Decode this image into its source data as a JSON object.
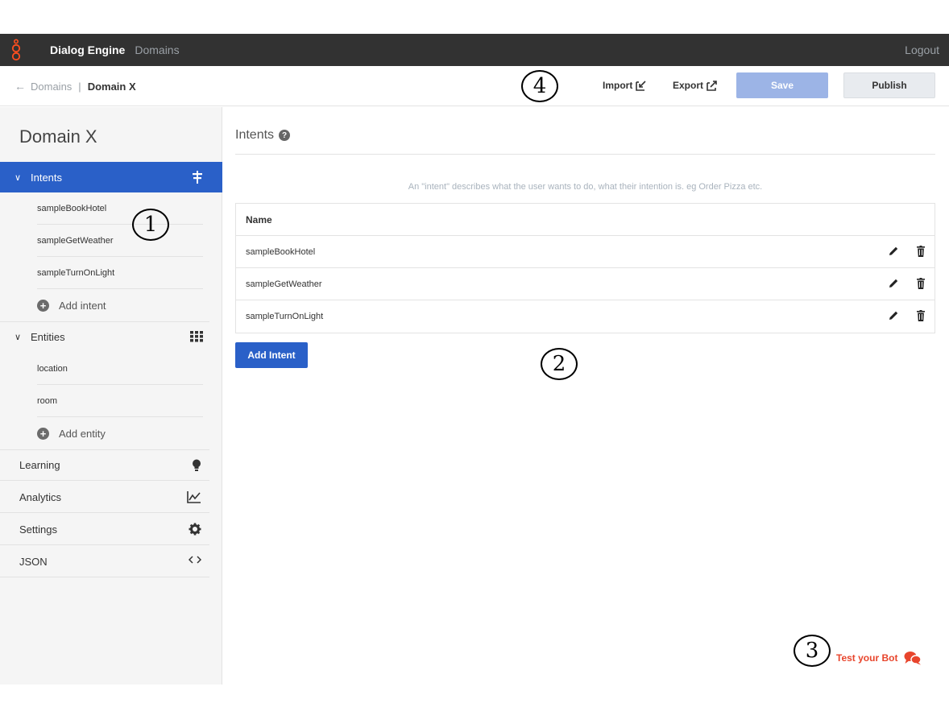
{
  "topbar": {
    "brand": "Dialog Engine",
    "nav_domains": "Domains",
    "logout": "Logout"
  },
  "toolbar": {
    "breadcrumb_parent": "Domains",
    "breadcrumb_separator": "|",
    "breadcrumb_current": "Domain X",
    "import_label": "Import",
    "export_label": "Export",
    "save_label": "Save",
    "publish_label": "Publish"
  },
  "sidebar": {
    "title": "Domain X",
    "intents": {
      "label": "Intents",
      "items": [
        "sampleBookHotel",
        "sampleGetWeather",
        "sampleTurnOnLight"
      ],
      "add_label": "Add intent"
    },
    "entities": {
      "label": "Entities",
      "items": [
        "location",
        "room"
      ],
      "add_label": "Add entity"
    },
    "rows": [
      {
        "label": "Learning",
        "icon": "lightbulb-icon"
      },
      {
        "label": "Analytics",
        "icon": "chart-icon"
      },
      {
        "label": "Settings",
        "icon": "gear-icon"
      },
      {
        "label": "JSON",
        "icon": "code-icon"
      }
    ]
  },
  "main": {
    "title": "Intents",
    "description": "An \"intent\" describes what the user wants to do, what their intention is. eg Order Pizza etc.",
    "table": {
      "header": "Name",
      "rows": [
        "sampleBookHotel",
        "sampleGetWeather",
        "sampleTurnOnLight"
      ]
    },
    "add_button": "Add Intent"
  },
  "test_bot": "Test your Bot",
  "callouts": [
    "1",
    "2",
    "3",
    "4"
  ],
  "colors": {
    "topbar": "#323232",
    "primary": "#2a60c8",
    "save_disabled": "#9cb4e6",
    "accent": "#e8452c",
    "sidebar_bg": "#f5f5f5"
  }
}
